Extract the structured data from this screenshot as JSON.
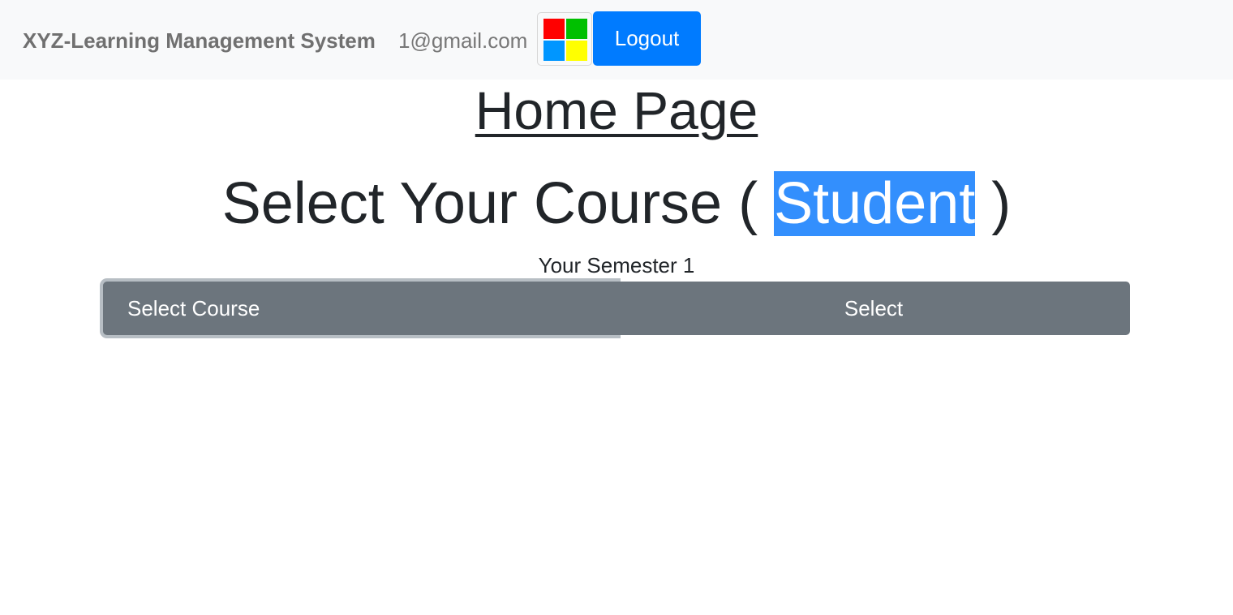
{
  "navbar": {
    "brand": "XYZ-Learning Management System",
    "email": "1@gmail.com",
    "logo_icon": "windows-logo-icon",
    "logo_colors": [
      "#ff0000",
      "#00c000",
      "#0096ff",
      "#ffff00"
    ],
    "logout_label": "Logout"
  },
  "main": {
    "page_title": "Home Page",
    "heading_prefix": "Select Your Course ( ",
    "heading_role": "Student",
    "heading_suffix": " )",
    "semester_text": "Your Semester 1",
    "course_select_label": "Select Course",
    "select_button_label": "Select"
  },
  "colors": {
    "primary": "#007bff",
    "secondary": "#6c757d",
    "highlight": "#338ffd"
  }
}
